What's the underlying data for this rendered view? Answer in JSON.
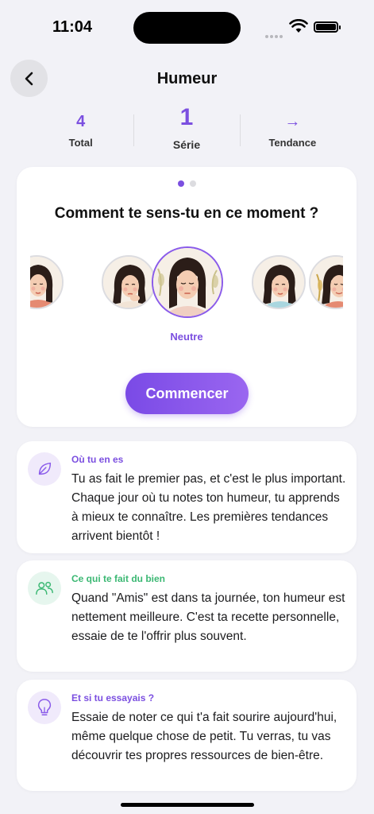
{
  "status": {
    "time": "11:04"
  },
  "nav": {
    "title": "Humeur"
  },
  "stats": [
    {
      "value": "4",
      "label": "Total"
    },
    {
      "value": "1",
      "label": "Série"
    },
    {
      "value": "→",
      "label": "Tendance"
    }
  ],
  "mood": {
    "question": "Comment te sens-tu en ce moment ?",
    "selected_label": "Neutre",
    "start_label": "Commencer",
    "page_count": 2,
    "active_page": 1
  },
  "insights": [
    {
      "title": "Où tu en es",
      "body": "Tu as fait le premier pas, et c'est le plus important. Chaque jour où tu notes ton humeur, tu apprends à mieux te connaître. Les premières tendances arrivent bientôt !",
      "icon": "leaf-icon",
      "color": "#7b4fe0"
    },
    {
      "title": "Ce qui te fait du bien",
      "body": "Quand \"Amis\" est dans ta journée, ton humeur est nettement meilleure. C'est ta recette personnelle, essaie de te l'offrir plus souvent.",
      "icon": "people-icon",
      "color": "#3bb873"
    },
    {
      "title": "Et si tu essayais ?",
      "body": "Essaie de noter ce qui t'a fait sourire aujourd'hui, même quelque chose de petit. Tu verras, tu vas découvrir tes propres ressources de bien-être.",
      "icon": "lightbulb-icon",
      "color": "#7b4fe0"
    }
  ]
}
